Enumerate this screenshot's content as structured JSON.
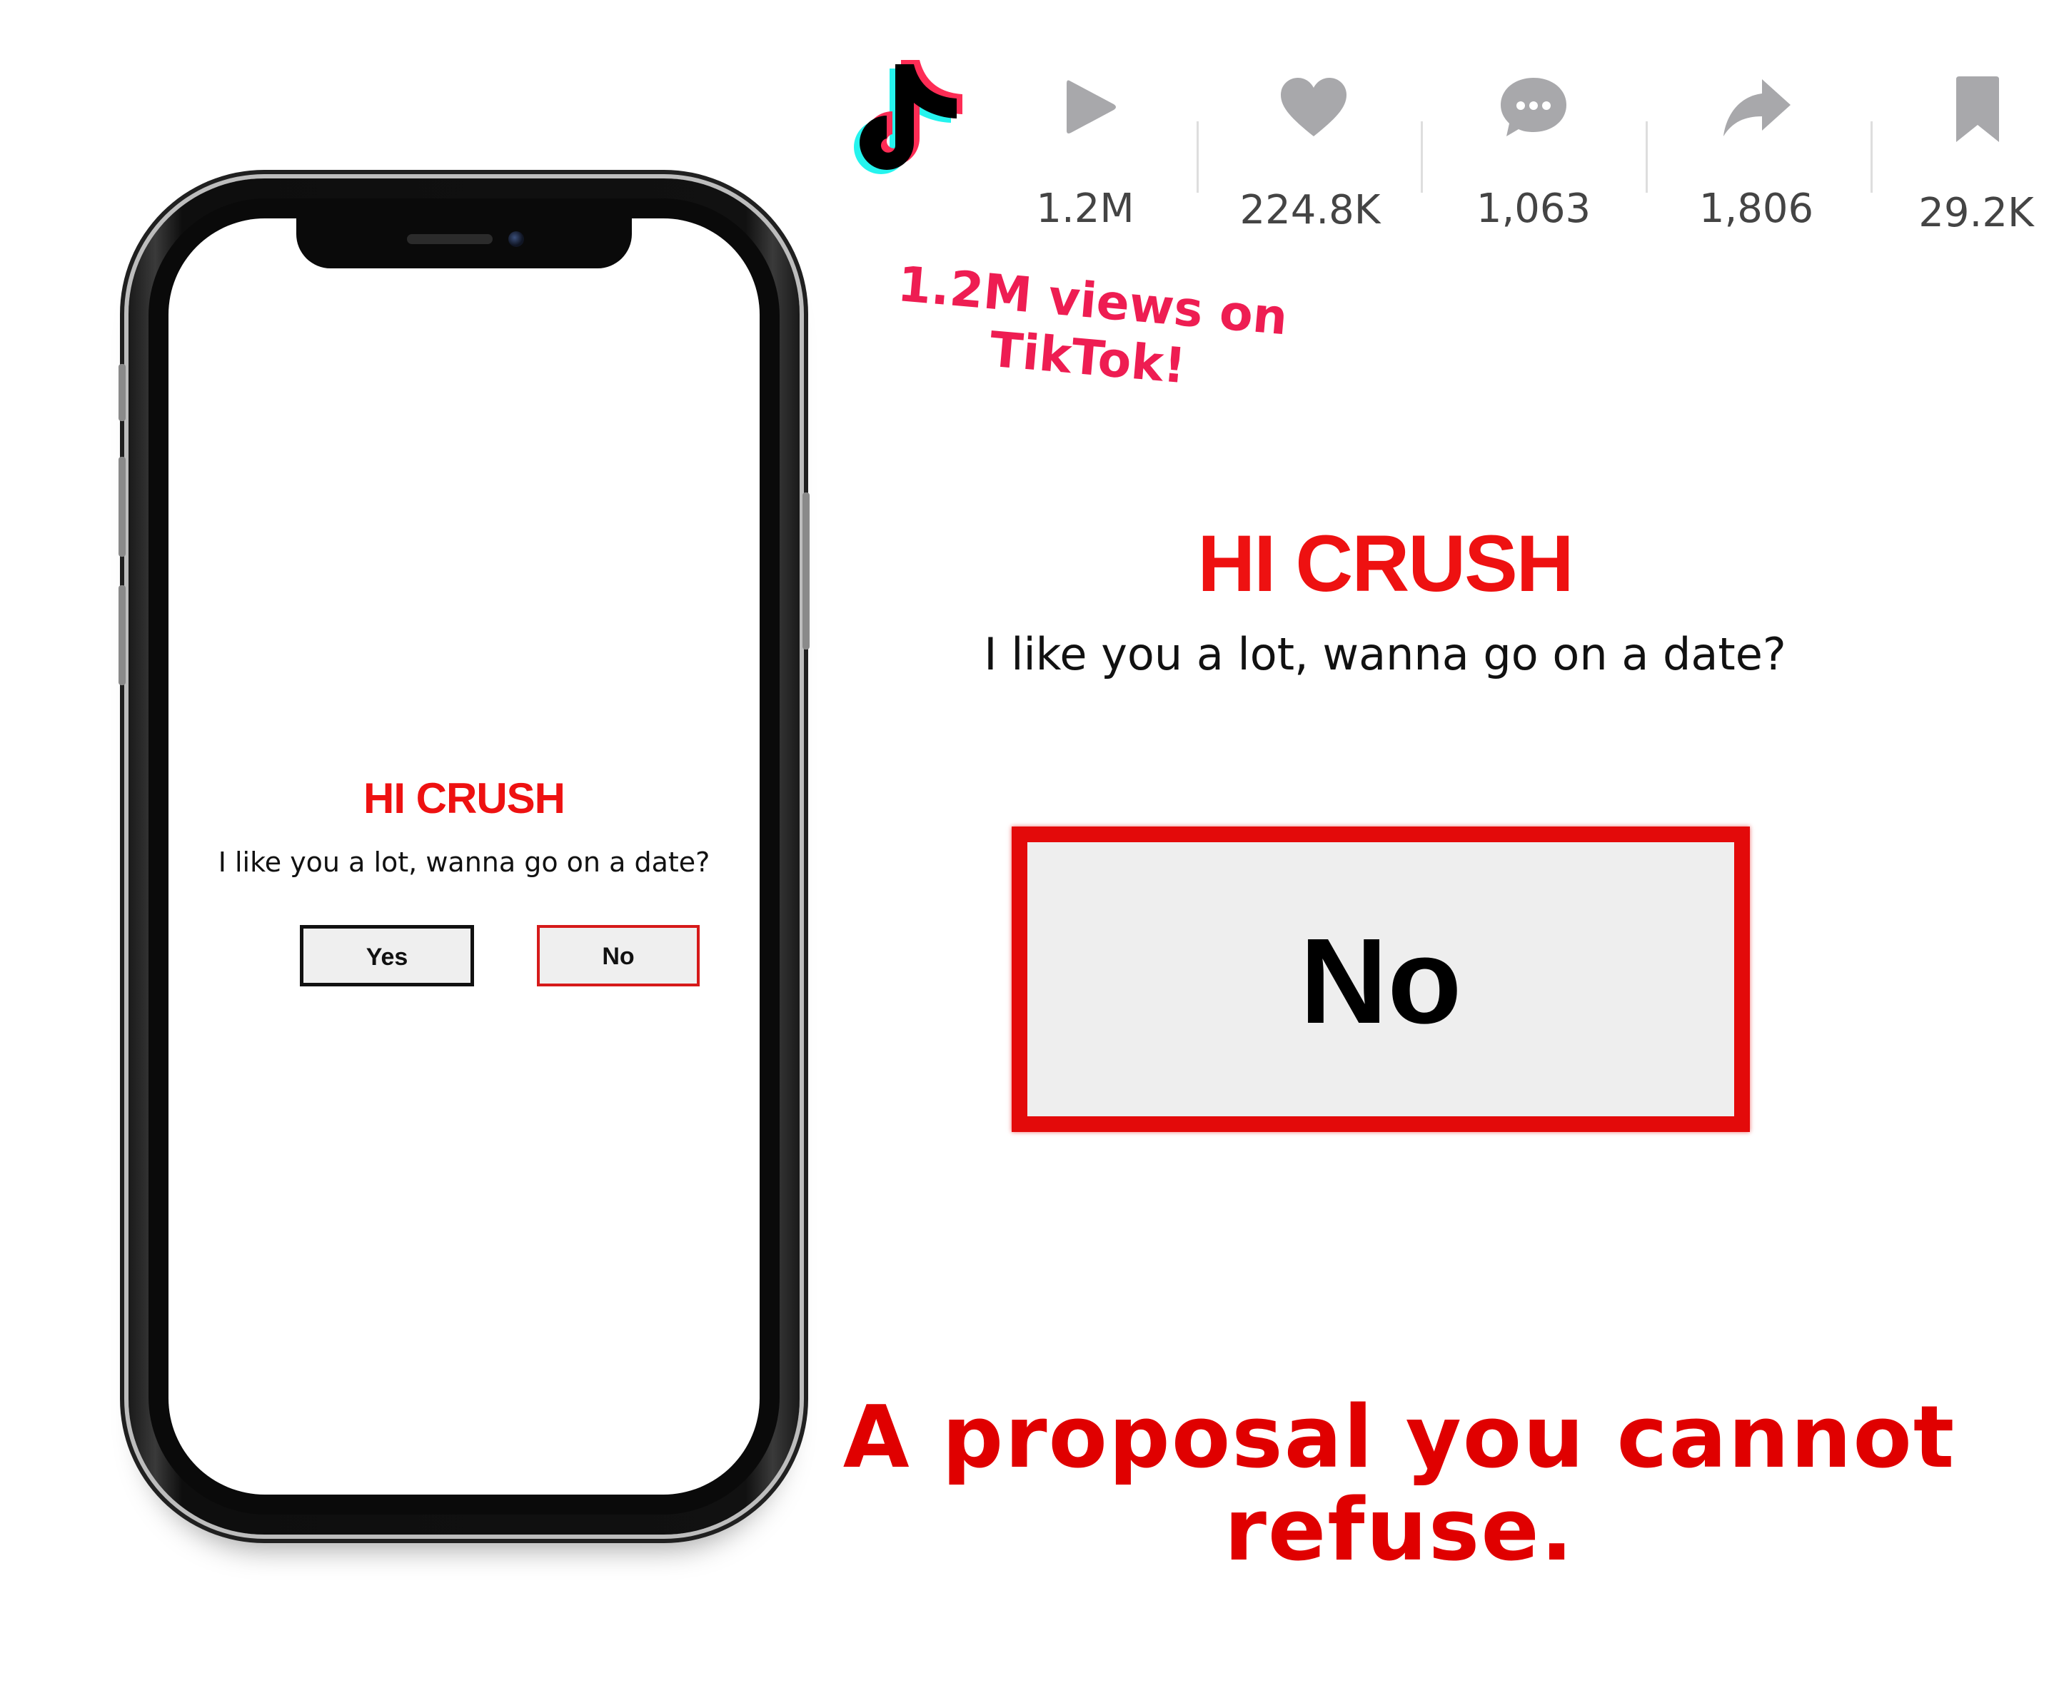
{
  "phone_screen": {
    "title": "HI CRUSH",
    "subtitle": "I like you a lot, wanna go on a date?",
    "yes_label": "Yes",
    "no_label": "No"
  },
  "tiktok_stats": {
    "logo_icon": "tiktok-logo",
    "items": [
      {
        "icon": "play-icon",
        "value": "1.2M"
      },
      {
        "icon": "heart-icon",
        "value": "224.8K"
      },
      {
        "icon": "comment-icon",
        "value": "1,063"
      },
      {
        "icon": "share-icon",
        "value": "1,806"
      },
      {
        "icon": "bookmark-icon",
        "value": "29.2K"
      }
    ]
  },
  "views_note": {
    "line1": "1.2M views on",
    "line2": "TikTok!"
  },
  "zoom": {
    "title": "HI CRUSH",
    "subtitle": "I like you a lot, wanna go on a date?",
    "no_label": "No"
  },
  "tagline": {
    "line1": "A proposal you cannot",
    "line2": "refuse."
  },
  "colors": {
    "crush_red": "#ee1111",
    "tiktok_pink": "#ee1d52",
    "tiktok_cyan": "#25f4ee",
    "tagline_red": "#e00000",
    "stat_gray": "#a8a8ab"
  }
}
